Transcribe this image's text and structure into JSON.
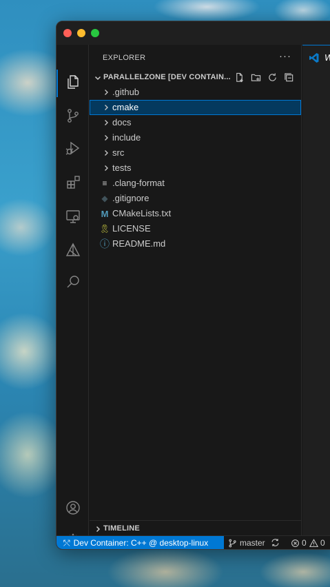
{
  "sidebar": {
    "title": "EXPLORER",
    "more": "···",
    "section_title": "PARALLELZONE [DEV CONTAIN...",
    "items": [
      {
        "label": ".github",
        "type": "folder",
        "icon": "chevron-right-icon"
      },
      {
        "label": "cmake",
        "type": "folder",
        "icon": "chevron-right-icon",
        "selected": true
      },
      {
        "label": "docs",
        "type": "folder",
        "icon": "chevron-right-icon"
      },
      {
        "label": "include",
        "type": "folder",
        "icon": "chevron-right-icon"
      },
      {
        "label": "src",
        "type": "folder",
        "icon": "chevron-right-icon"
      },
      {
        "label": "tests",
        "type": "folder",
        "icon": "chevron-right-icon"
      },
      {
        "label": ".clang-format",
        "type": "file",
        "icon": "lines-icon",
        "glyph": "≡",
        "color": "#cccccc"
      },
      {
        "label": ".gitignore",
        "type": "file",
        "icon": "git-icon",
        "glyph": "◆",
        "color": "#41535b"
      },
      {
        "label": "CMakeLists.txt",
        "type": "file",
        "icon": "cmake-icon",
        "glyph": "M",
        "color": "#519aba"
      },
      {
        "label": "LICENSE",
        "type": "file",
        "icon": "license-icon",
        "glyph": "🎗",
        "color": "#cbcb41"
      },
      {
        "label": "README.md",
        "type": "file",
        "icon": "info-icon",
        "glyph": "ⓘ",
        "color": "#519aba"
      }
    ],
    "timeline": "TIMELINE"
  },
  "editor": {
    "tab_label": "W"
  },
  "statusbar": {
    "remote_icon": "remote-icon",
    "remote": "Dev Container: C++ @ desktop-linux",
    "branch": "master",
    "errors": "0",
    "warnings": "0"
  },
  "colors": {
    "accent": "#0078d4",
    "selection": "#04395e"
  }
}
